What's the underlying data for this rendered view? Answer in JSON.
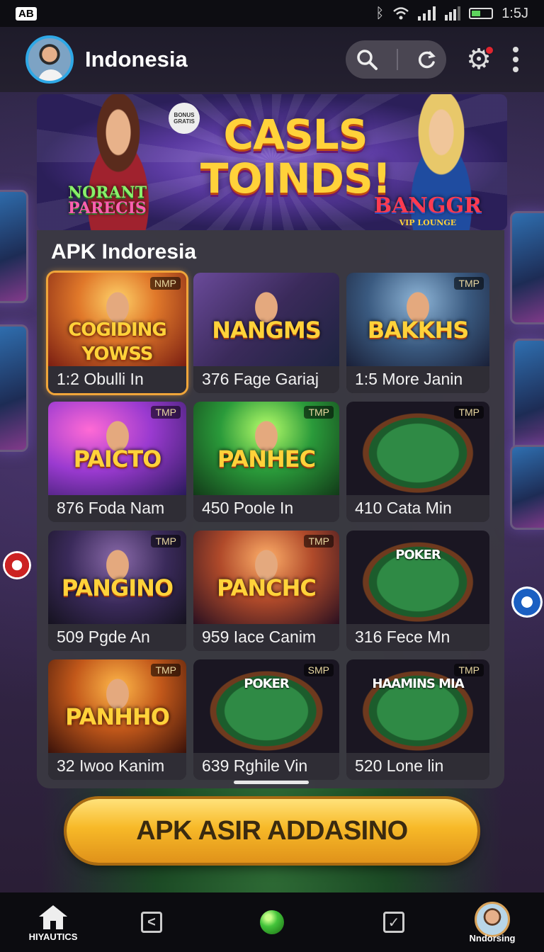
{
  "status_bar": {
    "app_badge": "AB",
    "time": "1:5J",
    "icons": [
      "bluetooth-icon",
      "wifi-icon",
      "signal-icon",
      "signal-icon",
      "battery-icon"
    ]
  },
  "header": {
    "title": "Indonesia",
    "avatar": "avatar",
    "search_icon": "search-icon",
    "refresh_icon": "refresh-icon",
    "settings_icon": "gear-icon",
    "menu_icon": "kebab-menu-icon"
  },
  "banner": {
    "headline_line1": "CASLS",
    "headline_line2": "TOINDS!",
    "sticker_text": "BONUS GRATIS",
    "tag_left_1": "NORANT",
    "tag_left_2": "PARECIS",
    "tag_right": "BANGGR",
    "tag_right_sub": "VIP LOUNGE"
  },
  "panel": {
    "title": "APK Indoresia",
    "cards": [
      {
        "title": "COGIDING YOWSS",
        "badge": "NMP",
        "caption": "1:2 Obulli  In",
        "theme": "gold-fire",
        "selected": true
      },
      {
        "title": "NANGMS",
        "badge": "",
        "caption": "376 Fage Gariaj",
        "theme": "cards-couple",
        "selected": false
      },
      {
        "title": "BAKKHS",
        "badge": "TMP",
        "caption": "1:5 More Janin",
        "theme": "cowgirl",
        "selected": false
      },
      {
        "title": "PAICTO",
        "badge": "TMP",
        "caption": "876 Foda Nam",
        "theme": "purple-hero",
        "selected": false
      },
      {
        "title": "PANHEC",
        "badge": "TMP",
        "caption": "450 Poole  In",
        "theme": "green-hero",
        "selected": false
      },
      {
        "title": "",
        "badge": "TMP",
        "caption": "410 Cata  Min",
        "theme": "felt-table",
        "selected": false
      },
      {
        "title": "PANGINO",
        "badge": "TMP",
        "caption": "509 Pgde  An",
        "theme": "dark-hero",
        "selected": false
      },
      {
        "title": "PANCHC",
        "badge": "TMP",
        "caption": "959 Iace Canim",
        "theme": "neon-hero",
        "selected": false
      },
      {
        "title": "POKER",
        "badge": "",
        "caption": "316 Fece  Mn",
        "theme": "felt-table",
        "selected": false
      },
      {
        "title": "PANHHO",
        "badge": "TMP",
        "caption": "32 Iwoo  Kanim",
        "theme": "singer",
        "selected": false
      },
      {
        "title": "POKER",
        "badge": "SMP",
        "caption": "639 Rghile  Vin",
        "theme": "felt-table",
        "selected": false
      },
      {
        "title": "HAAMINS MIA",
        "badge": "TMP",
        "caption": "520 Lone  lin",
        "theme": "felt-table",
        "selected": false
      }
    ]
  },
  "cta": {
    "label": "APK ASIR ADDASINO"
  },
  "bottom_nav": {
    "home_label": "HIYAUTICS",
    "profile_label": "Nndorsing"
  },
  "colors": {
    "accent_gold": "#f7b928",
    "selected_outline": "#f0a53a",
    "avatar_ring": "#2fa8e6",
    "notification": "#e0252f"
  }
}
